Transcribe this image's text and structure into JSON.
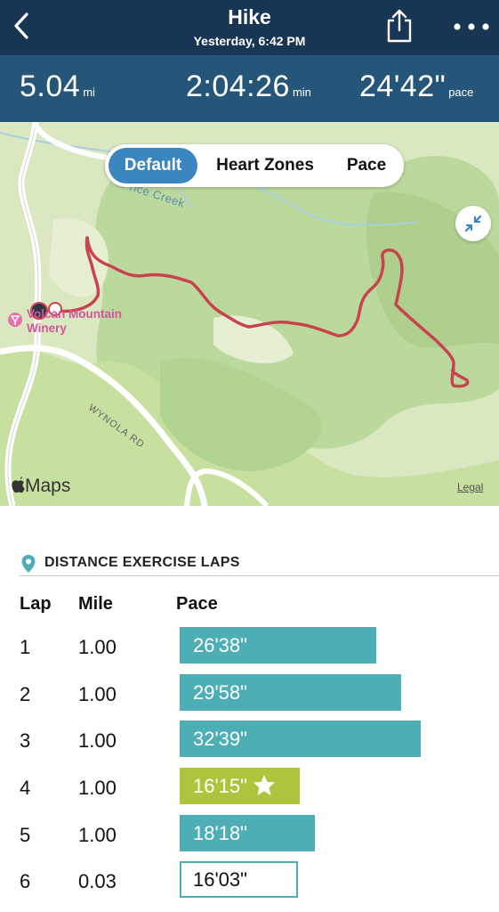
{
  "header": {
    "title": "Hike",
    "subtitle": "Yesterday, 6:42 PM",
    "back_icon": "chevron-left-icon",
    "share_icon": "share-icon",
    "more_icon": "more-horizontal-icon"
  },
  "stats": {
    "distance": {
      "value": "5.04",
      "unit": "mi"
    },
    "duration": {
      "value": "2:04:26",
      "unit": "min"
    },
    "pace": {
      "value": "24'42\"",
      "unit": "pace"
    }
  },
  "map": {
    "segments": [
      "Default",
      "Heart Zones",
      "Pace"
    ],
    "selected_segment": "Default",
    "place_label_line1": "Volcan Mountain",
    "place_label_line2": "Winery",
    "road_label": "WYNOLA RD",
    "creek_label": "Price Creek",
    "brand": "Maps",
    "legal": "Legal",
    "route_color": "#c9434f"
  },
  "laps": {
    "section_title": "DISTANCE EXERCISE LAPS",
    "columns": {
      "lap": "Lap",
      "mile": "Mile",
      "pace": "Pace"
    },
    "rows": [
      {
        "lap": "1",
        "mile": "1.00",
        "pace": "26'38\"",
        "pace_minutes": 26.63,
        "style": "normal"
      },
      {
        "lap": "2",
        "mile": "1.00",
        "pace": "29'58\"",
        "pace_minutes": 29.97,
        "style": "normal"
      },
      {
        "lap": "3",
        "mile": "1.00",
        "pace": "32'39\"",
        "pace_minutes": 32.65,
        "style": "normal"
      },
      {
        "lap": "4",
        "mile": "1.00",
        "pace": "16'15\"",
        "pace_minutes": 16.25,
        "style": "best"
      },
      {
        "lap": "5",
        "mile": "1.00",
        "pace": "18'18\"",
        "pace_minutes": 18.3,
        "style": "normal"
      },
      {
        "lap": "6",
        "mile": "0.03",
        "pace": "16'03\"",
        "pace_minutes": 16.05,
        "style": "partial"
      }
    ],
    "colors": {
      "normal": "#4eaeb5",
      "best": "#afc33d"
    }
  }
}
